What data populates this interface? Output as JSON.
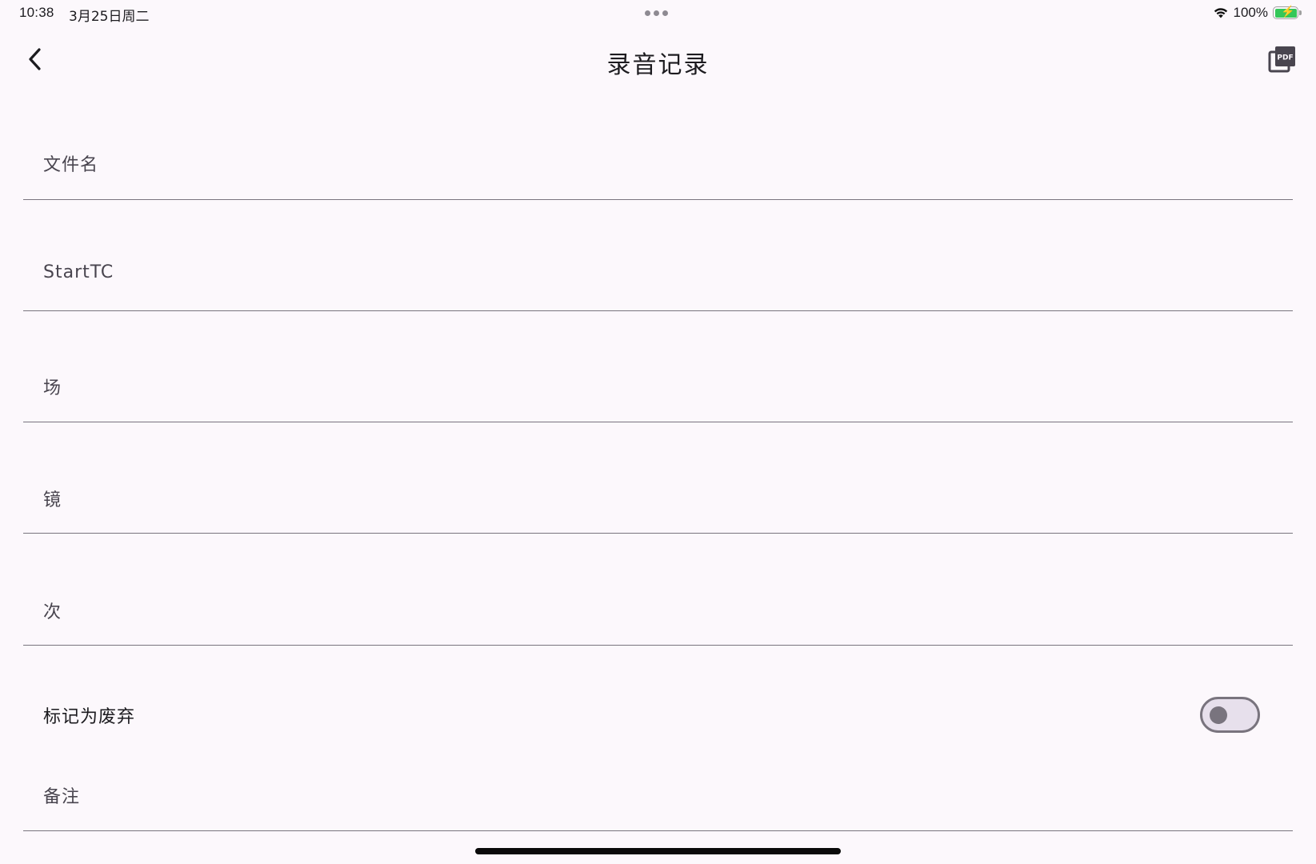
{
  "status_bar": {
    "time": "10:38",
    "date": "3月25日周二",
    "battery": "100%",
    "wifi_icon": "wifi-icon",
    "battery_icon": "battery-charging-icon"
  },
  "app_bar": {
    "title": "录音记录",
    "back_icon": "chevron-left-icon",
    "pdf_icon": "pdf-export-icon"
  },
  "form": {
    "fields": [
      {
        "label": "文件名",
        "value": ""
      },
      {
        "label": "StartTC",
        "value": ""
      },
      {
        "label": "场",
        "value": ""
      },
      {
        "label": "镜",
        "value": ""
      },
      {
        "label": "次",
        "value": ""
      }
    ],
    "discard_switch": {
      "label": "标记为废弃",
      "on": false
    },
    "notes": {
      "label": "备注",
      "value": ""
    }
  },
  "colors": {
    "background": "#fcf8fc",
    "underline": "#79747e",
    "switch_track": "#e7e0ec",
    "battery_fill": "#34c759"
  }
}
